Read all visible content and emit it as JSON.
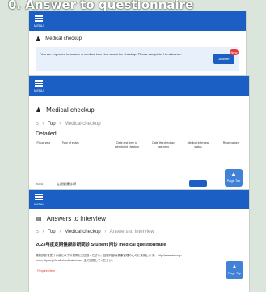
{
  "heading": "0. Answer to questionnaire",
  "common": {
    "menu_label": "MENU",
    "page_top_label": "Page Top",
    "page_top_arrow": "▲",
    "breadcrumb_separator": "›"
  },
  "shot1": {
    "title": "Medical checkup",
    "notice": {
      "text": "You are expected to answer a medical interview about the checkup. Please complete it in advance.",
      "button_label": "Answer",
      "badge": "New"
    }
  },
  "shot2": {
    "title": "Medical checkup",
    "breadcrumb": [
      "Top",
      "Medical checkup"
    ],
    "subheading": "Detailed",
    "columns": [
      "Fiscal year",
      "Type of exam",
      "Date and time of scheduled checkup",
      "Date the checkup has been",
      "Medical interview status",
      "Reservations"
    ],
    "row": {
      "year": "2023",
      "type": "定期健康診断"
    }
  },
  "shot3": {
    "title": "Answers to interview",
    "breadcrumb": [
      "Top",
      "Medical checkup",
      "Answers to interview"
    ],
    "questionnaire_title": "2023年度定期健康診断問診 Student 问诊 medical questionnaire",
    "questionnaire_text": "健康診断を受ける前に以下の質問にご回答ください。回答内容は健康管理のために使用します。 http://www.dummy-university.ac.jp/health/medical/privacy 全て回答してください。",
    "required_note": "* Required item"
  }
}
